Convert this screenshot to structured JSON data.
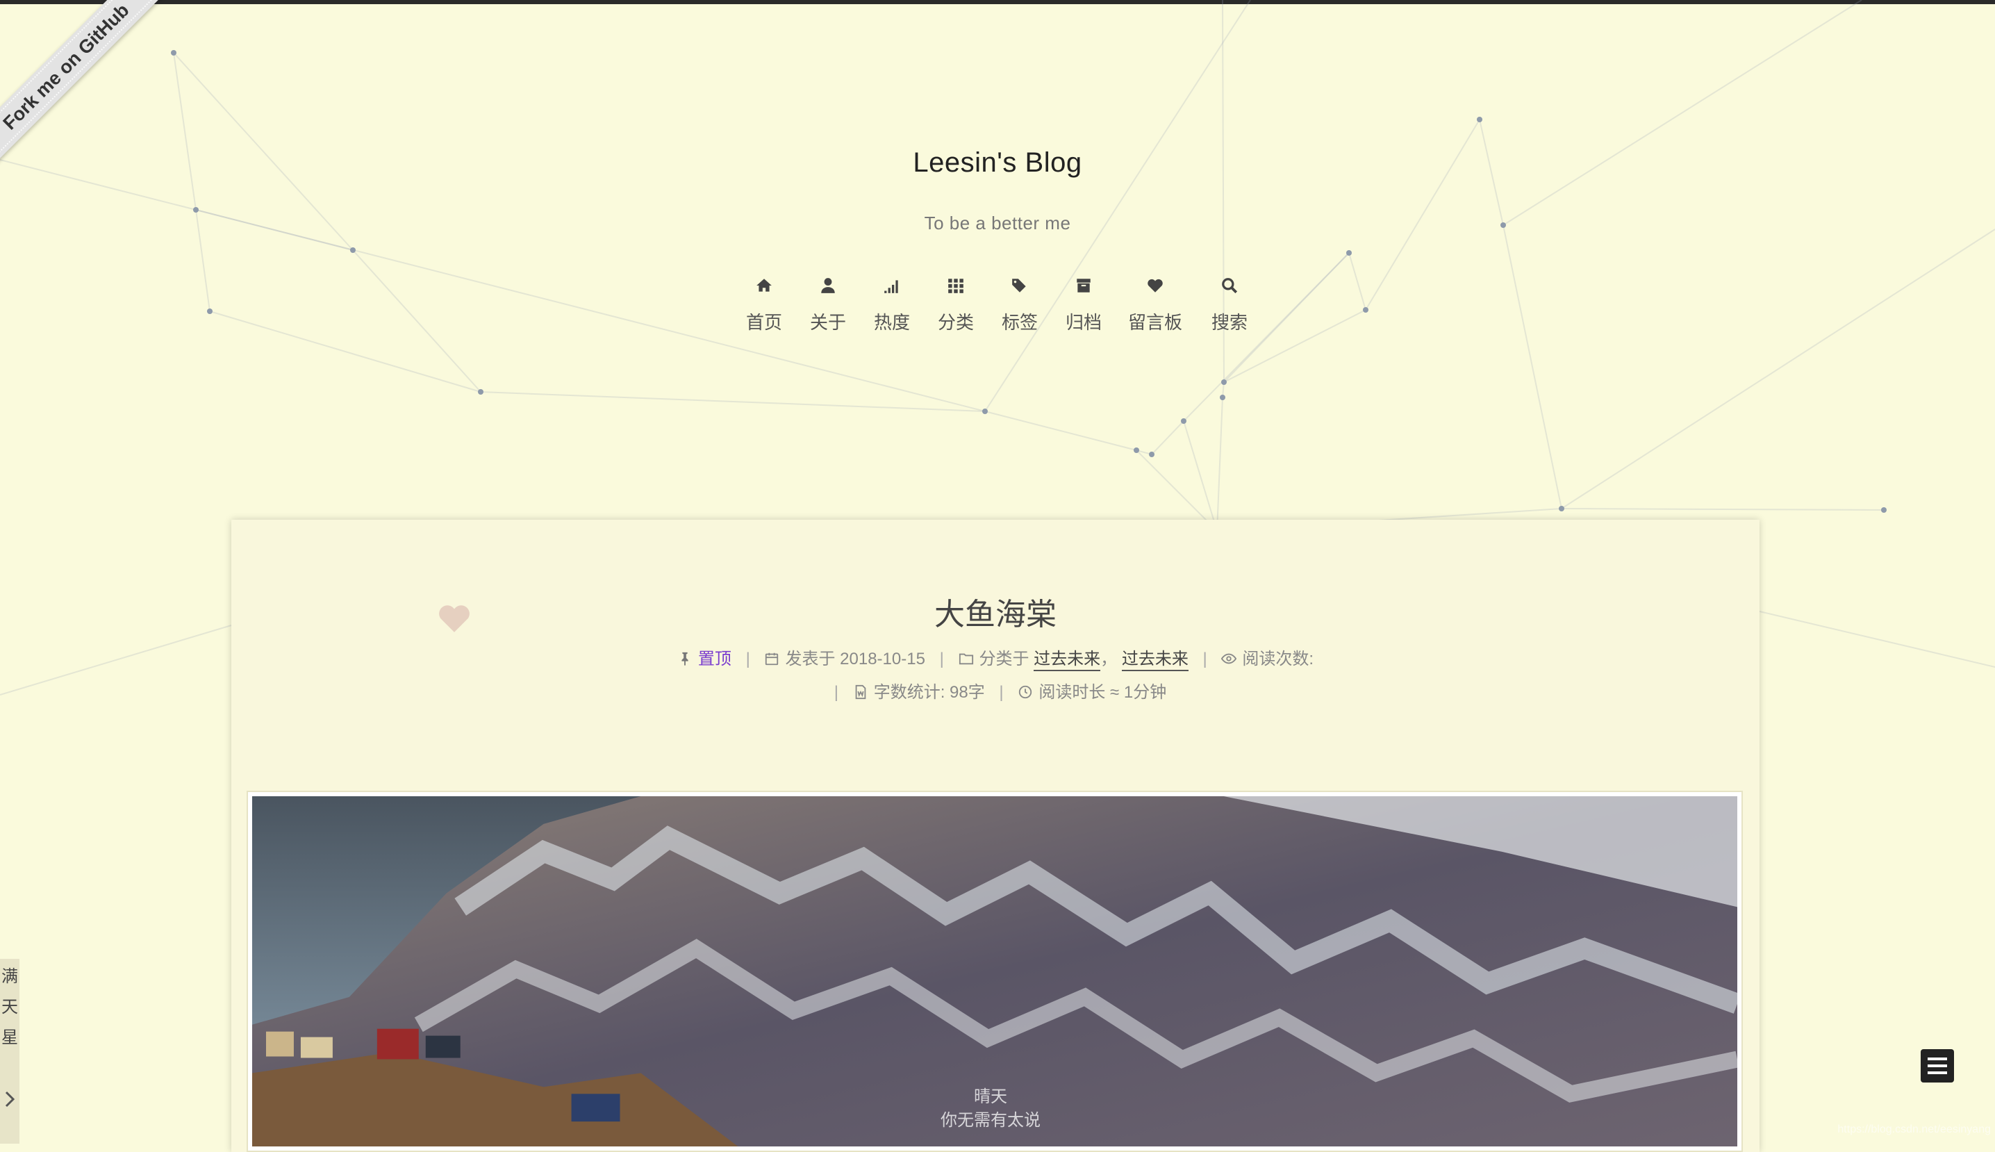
{
  "ribbon": {
    "label": "Fork me on GitHub"
  },
  "header": {
    "title": "Leesin's Blog",
    "subtitle": "To be a better me"
  },
  "nav": [
    {
      "label": "首页",
      "icon": "home-icon"
    },
    {
      "label": "关于",
      "icon": "user-icon"
    },
    {
      "label": "热度",
      "icon": "signal-icon"
    },
    {
      "label": "分类",
      "icon": "grid-icon"
    },
    {
      "label": "标签",
      "icon": "tags-icon"
    },
    {
      "label": "归档",
      "icon": "archive-icon"
    },
    {
      "label": "留言板",
      "icon": "heart-icon"
    },
    {
      "label": "搜索",
      "icon": "search-icon"
    }
  ],
  "post": {
    "title": "大鱼海棠",
    "pinned_label": "置顶",
    "published_label": "发表于",
    "published_date": "2018-10-15",
    "category_label": "分类于",
    "categories": [
      "过去未来",
      "过去未来"
    ],
    "category_comma": "，",
    "views_label": "阅读次数:",
    "wordcount_label": "字数统计:",
    "wordcount_value": "98字",
    "readtime_label": "阅读时长 ≈",
    "readtime_value": "1分钟",
    "image_caption_1": "晴天",
    "image_caption_2": "你无需有太说"
  },
  "side_widget": {
    "chars": [
      "满",
      "天",
      "星"
    ]
  },
  "colors": {
    "background": "#fafadc",
    "card": "#f9f7dc",
    "accent_pinned": "#7a3ccf",
    "topbar": "#2a2a2a"
  },
  "watermark": "https://blog.csdn.net/eesinyang"
}
